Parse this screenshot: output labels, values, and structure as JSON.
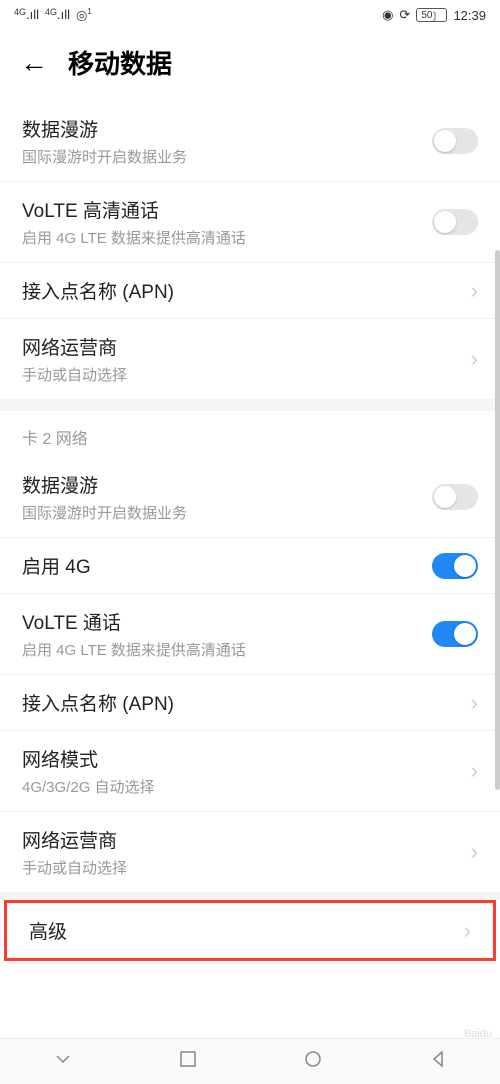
{
  "status": {
    "signal1_text": "4G",
    "signal2_text": "4G",
    "wifi_badge": "1",
    "battery": "50",
    "time": "12:39"
  },
  "header": {
    "title": "移动数据"
  },
  "sim1": {
    "roaming": {
      "title": "数据漫游",
      "sub": "国际漫游时开启数据业务",
      "on": false
    },
    "volte": {
      "title": "VoLTE 高清通话",
      "sub": "启用 4G LTE 数据来提供高清通话",
      "on": false
    },
    "apn": {
      "title": "接入点名称 (APN)"
    },
    "carrier": {
      "title": "网络运营商",
      "sub": "手动或自动选择"
    }
  },
  "section2_header": "卡 2 网络",
  "sim2": {
    "roaming": {
      "title": "数据漫游",
      "sub": "国际漫游时开启数据业务",
      "on": false
    },
    "enable4g": {
      "title": "启用 4G",
      "on": true
    },
    "volte": {
      "title": "VoLTE 通话",
      "sub": "启用 4G LTE 数据来提供高清通话",
      "on": true
    },
    "apn": {
      "title": "接入点名称 (APN)"
    },
    "netmode": {
      "title": "网络模式",
      "sub": "4G/3G/2G 自动选择"
    },
    "carrier": {
      "title": "网络运营商",
      "sub": "手动或自动选择"
    }
  },
  "advanced": {
    "title": "高级"
  }
}
